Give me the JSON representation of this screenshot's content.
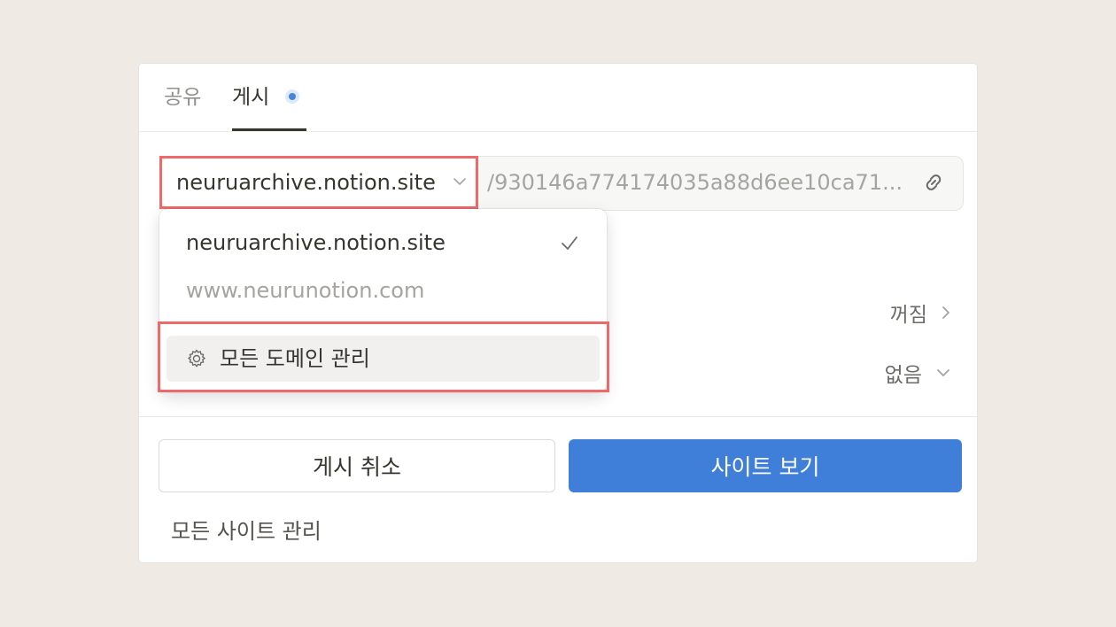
{
  "tabs": {
    "share": "공유",
    "publish": "게시"
  },
  "url": {
    "domain": "neuruarchive.notion.site",
    "path": "/930146a774174035a88d6ee10ca71..."
  },
  "settings": {
    "row1_value": "꺼짐",
    "row2_value": "없음"
  },
  "dropdown": {
    "options": [
      {
        "label": "neuruarchive.notion.site",
        "selected": true
      },
      {
        "label": "www.neurunotion.com",
        "selected": false
      }
    ],
    "manage_label": "모든 도메인 관리"
  },
  "buttons": {
    "unpublish": "게시 취소",
    "view_site": "사이트 보기"
  },
  "footer": {
    "manage_sites": "모든 사이트 관리"
  },
  "colors": {
    "accent": "#3f7fd9",
    "highlight": "#ee6a6a",
    "background": "#efebe4"
  },
  "icons": [
    "chevron-down-icon",
    "link-icon",
    "check-icon",
    "gear-icon",
    "chevron-right-icon"
  ]
}
